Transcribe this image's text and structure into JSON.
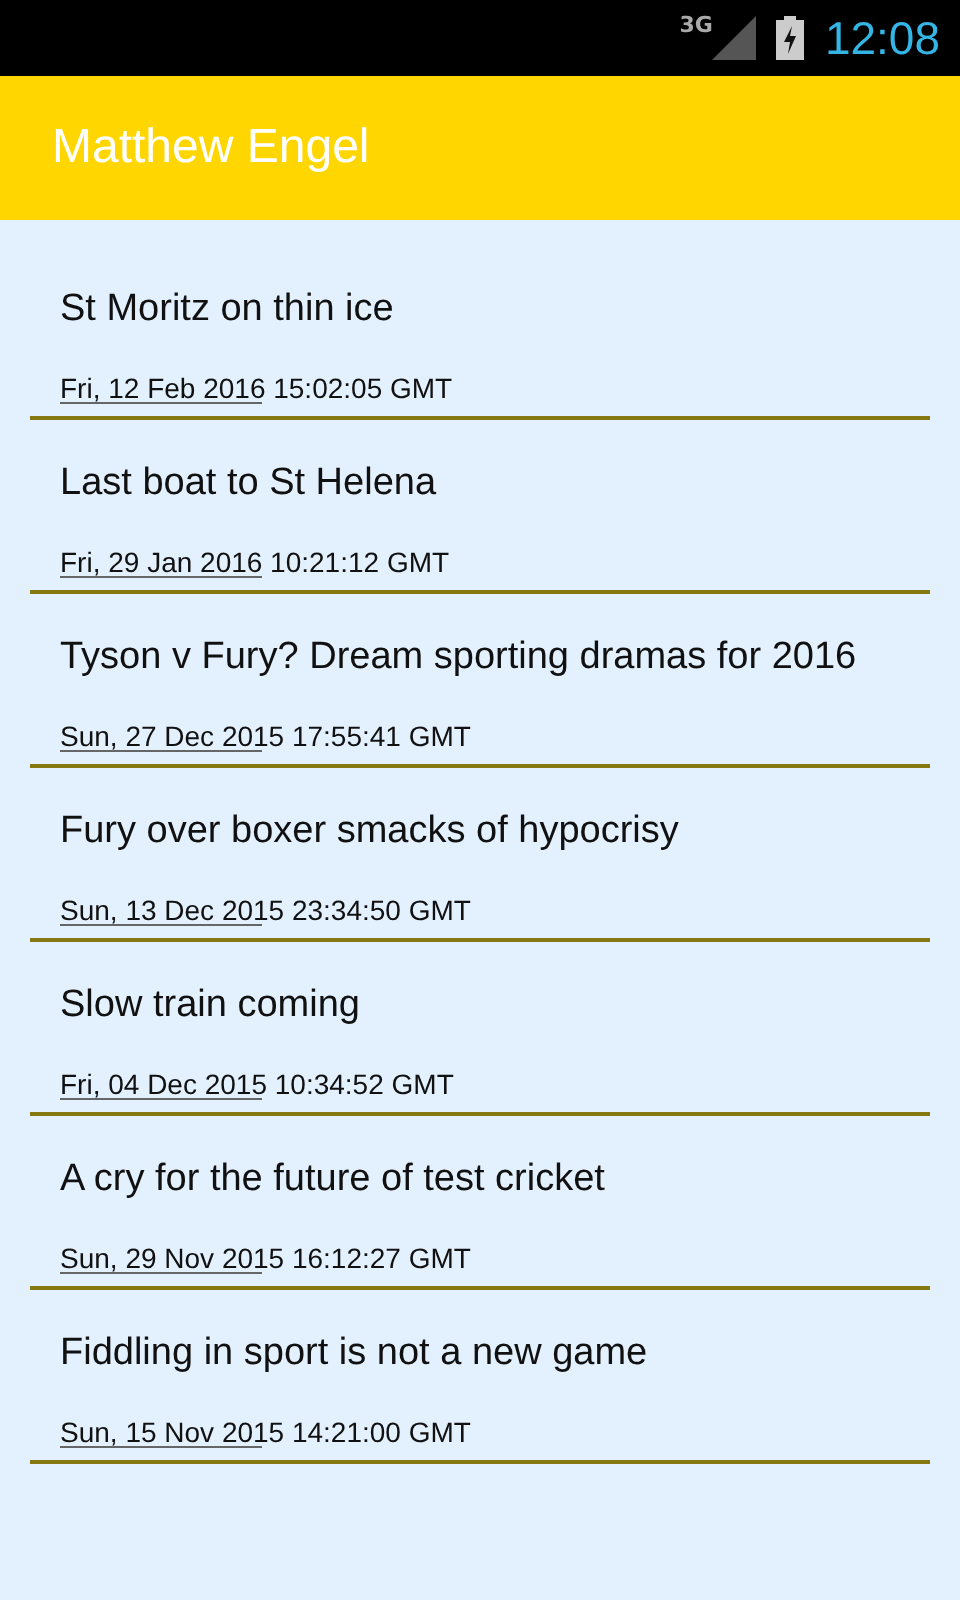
{
  "status_bar": {
    "network": "3G",
    "time": "12:08"
  },
  "app_bar": {
    "title": "Matthew Engel"
  },
  "articles": [
    {
      "title": "St Moritz on thin ice",
      "date": "Fri, 12 Feb 2016 15:02:05 GMT"
    },
    {
      "title": "Last boat to St Helena",
      "date": "Fri, 29 Jan 2016 10:21:12 GMT"
    },
    {
      "title": "Tyson v Fury? Dream sporting dramas for 2016",
      "date": "Sun, 27 Dec 2015 17:55:41 GMT"
    },
    {
      "title": "Fury over boxer smacks of hypocrisy",
      "date": "Sun, 13 Dec 2015 23:34:50 GMT"
    },
    {
      "title": "Slow train coming",
      "date": "Fri, 04 Dec 2015 10:34:52 GMT"
    },
    {
      "title": "A cry for the future of test cricket",
      "date": "Sun, 29 Nov 2015 16:12:27 GMT"
    },
    {
      "title": "Fiddling in sport is not a new game",
      "date": "Sun, 15 Nov 2015 14:21:00 GMT"
    }
  ]
}
